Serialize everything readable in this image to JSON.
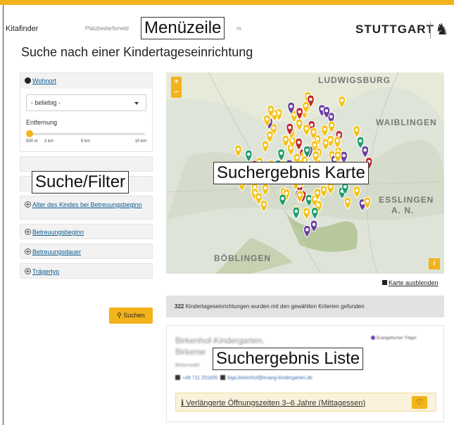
{
  "header": {
    "brand": "Kitafinder",
    "nav_link_left": "Platzbedarfsmeld",
    "nav_link_right": "m",
    "logo_text": "STUTTGART",
    "crest_glyph": "♞"
  },
  "annotations": {
    "menu_bar": "Menüzeile",
    "search_filter": "Suche/Filter",
    "map_results": "Suchergebnis Karte",
    "list_results": "Suchergebnis Liste"
  },
  "page_title": "Suche nach einer Kindertageseinrichtung",
  "filters": {
    "residence": {
      "label": "Wohnort",
      "select_value": "- beliebig -",
      "distance_label": "Entfernung",
      "distance_value_fraction": 0,
      "ticks": [
        "500 m",
        "2 km",
        "5 km",
        "10 km"
      ]
    },
    "age_label": "Alter des Kindes bei Betreuungsbeginn",
    "start_label": "Betreuungsbeginn",
    "duration_label": "Betreuungsdauer",
    "provider_label": "Trägertyp",
    "search_button": "Suchen"
  },
  "map": {
    "places": [
      "LUDWIGSBURG",
      "WAIBLINGEN",
      "ESSLINGEN",
      "A. N.",
      "BÖBLINGEN"
    ],
    "zoom_in": "+",
    "zoom_out": "−",
    "info": "i",
    "hide_label": "Karte ausblenden",
    "colors": {
      "yellow": "#f2c21b",
      "purple": "#6a3fa0",
      "green": "#1f9d6a",
      "red": "#c0282d"
    }
  },
  "results": {
    "count": "322",
    "summary": "Kindertageseinrichtungen wurden mit den gewählten Kriterien gefunden"
  },
  "card": {
    "name_line1": "Birkenhof-Kindergarten,",
    "name_line2": "Birkenw",
    "address": "Birkenwald",
    "provider": "Evangelischer Träger",
    "phone": "+49 711 251835",
    "email": "kiga.birkenhof@evang-kindergarten.de",
    "feature": "Verlängerte Öffnungszeiten 3–6 Jahre (Mittagessen)"
  }
}
